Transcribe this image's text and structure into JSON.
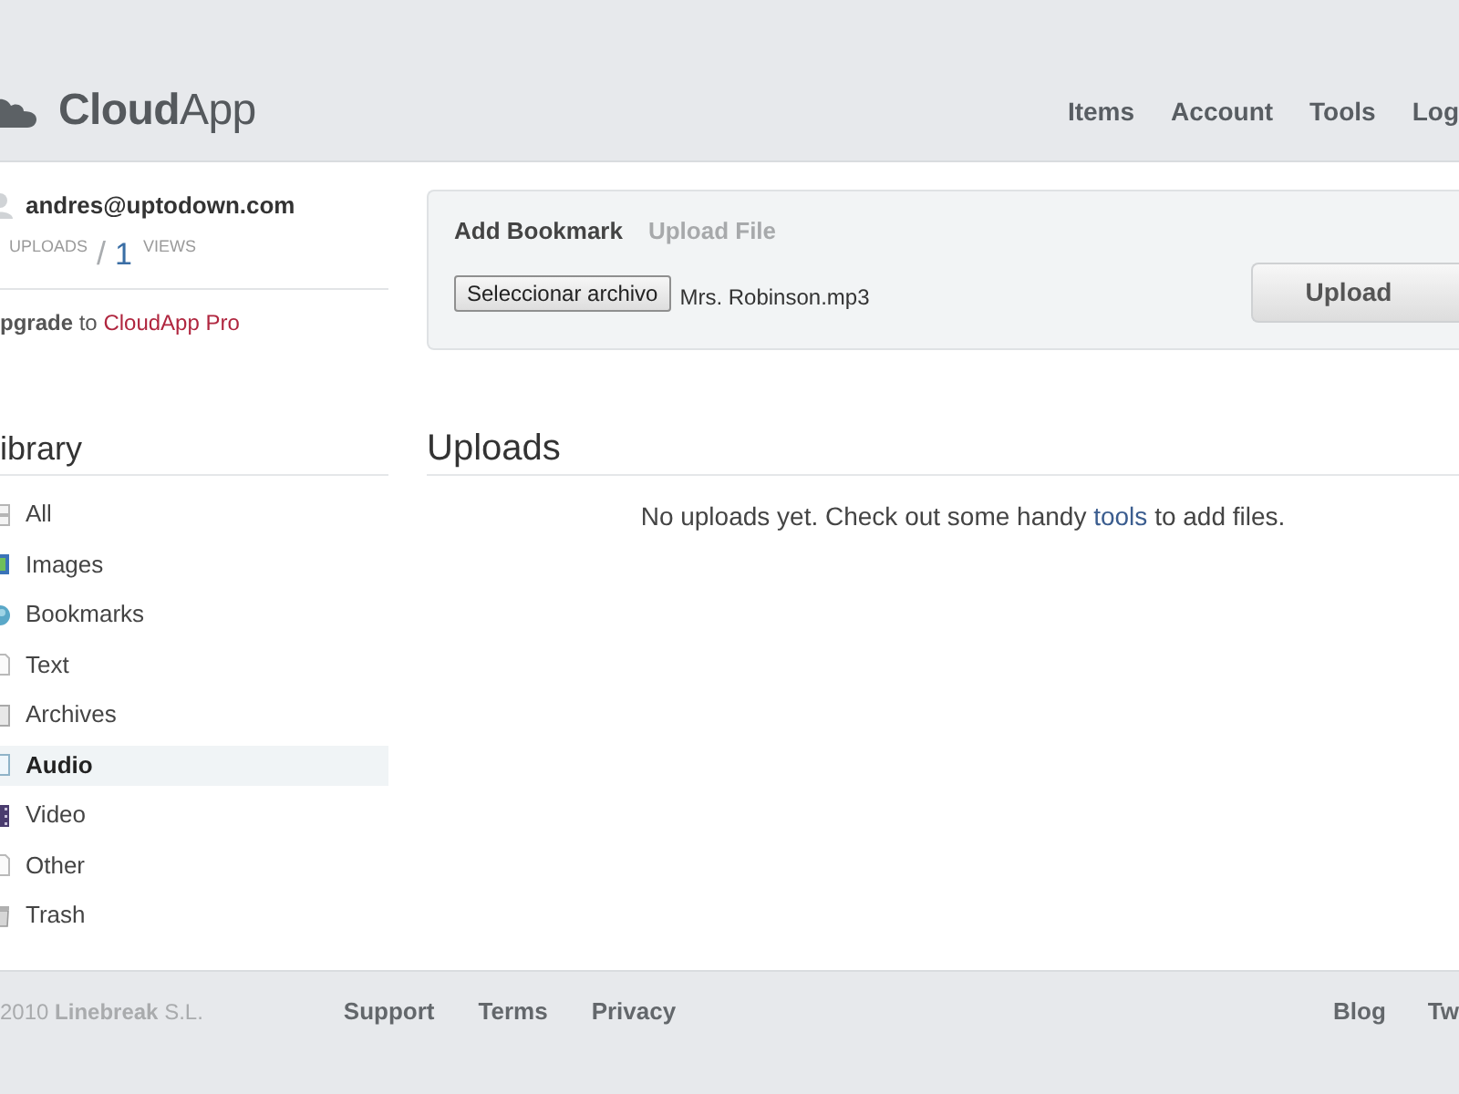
{
  "header": {
    "logo": {
      "strong": "Cloud",
      "light": "App"
    },
    "nav": [
      "Items",
      "Account",
      "Tools",
      "Log"
    ]
  },
  "account": {
    "email": "andres@uptodown.com",
    "stats": [
      {
        "label": "UPLOADS"
      },
      {
        "count": "1",
        "label": "VIEWS"
      }
    ],
    "separator": "/",
    "upgrade": {
      "text": "**pgrade** to",
      "link": "CloudApp Pro"
    }
  },
  "library": {
    "title": "ibrary",
    "items": [
      {
        "kind": "all",
        "label": "All",
        "selected": false
      },
      {
        "kind": "image",
        "label": "Images",
        "selected": false
      },
      {
        "kind": "bookmark",
        "label": "Bookmarks",
        "selected": false
      },
      {
        "kind": "text",
        "label": "Text",
        "selected": false
      },
      {
        "kind": "archive",
        "label": "Archives",
        "selected": false
      },
      {
        "kind": "audio",
        "label": "Audio",
        "selected": true
      },
      {
        "kind": "video",
        "label": "Video",
        "selected": false
      },
      {
        "kind": "other",
        "label": "Other",
        "selected": false
      },
      {
        "kind": "trash",
        "label": "Trash",
        "selected": false
      }
    ]
  },
  "upload_panel": {
    "tabs": [
      {
        "label": "Add Bookmark",
        "selected": true
      },
      {
        "label": "Upload File",
        "selected": false
      }
    ],
    "file_button": "Seleccionar archivo",
    "file_name": "Mrs. Robinson.mp3",
    "submit": "Upload"
  },
  "uploads": {
    "title": "Uploads",
    "message": {
      "before": "No uploads yet. Check out some handy",
      "link": "tools",
      "after": "to add files."
    }
  },
  "footer": {
    "copyright": "2010 **Linebreak** S.L.",
    "links": [
      "Support",
      "Terms",
      "Privacy"
    ],
    "links_right": [
      "Blog",
      "Tw"
    ]
  }
}
